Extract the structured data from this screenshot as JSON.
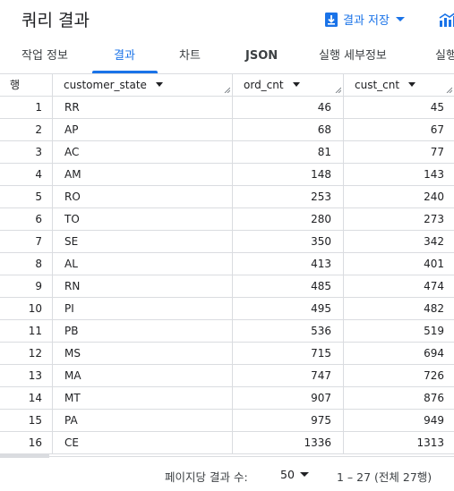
{
  "header": {
    "title": "쿼리 결과",
    "save_label": "결과 저장"
  },
  "tabs": [
    {
      "label": "작업 정보"
    },
    {
      "label": "결과"
    },
    {
      "label": "차트"
    },
    {
      "label": "JSON"
    },
    {
      "label": "실행 세부정보"
    },
    {
      "label": "실행"
    }
  ],
  "table": {
    "row_header": "행",
    "columns": [
      "customer_state",
      "ord_cnt",
      "cust_cnt"
    ],
    "rows": [
      {
        "n": "1",
        "state": "RR",
        "ord": "46",
        "cust": "45"
      },
      {
        "n": "2",
        "state": "AP",
        "ord": "68",
        "cust": "67"
      },
      {
        "n": "3",
        "state": "AC",
        "ord": "81",
        "cust": "77"
      },
      {
        "n": "4",
        "state": "AM",
        "ord": "148",
        "cust": "143"
      },
      {
        "n": "5",
        "state": "RO",
        "ord": "253",
        "cust": "240"
      },
      {
        "n": "6",
        "state": "TO",
        "ord": "280",
        "cust": "273"
      },
      {
        "n": "7",
        "state": "SE",
        "ord": "350",
        "cust": "342"
      },
      {
        "n": "8",
        "state": "AL",
        "ord": "413",
        "cust": "401"
      },
      {
        "n": "9",
        "state": "RN",
        "ord": "485",
        "cust": "474"
      },
      {
        "n": "10",
        "state": "PI",
        "ord": "495",
        "cust": "482"
      },
      {
        "n": "11",
        "state": "PB",
        "ord": "536",
        "cust": "519"
      },
      {
        "n": "12",
        "state": "MS",
        "ord": "715",
        "cust": "694"
      },
      {
        "n": "13",
        "state": "MA",
        "ord": "747",
        "cust": "726"
      },
      {
        "n": "14",
        "state": "MT",
        "ord": "907",
        "cust": "876"
      },
      {
        "n": "15",
        "state": "PA",
        "ord": "975",
        "cust": "949"
      },
      {
        "n": "16",
        "state": "CE",
        "ord": "1336",
        "cust": "1313"
      }
    ]
  },
  "footer": {
    "per_page_label": "페이지당 결과 수:",
    "per_page_value": "50",
    "range": "1 – 27 (전체 27행)"
  },
  "colors": {
    "accent": "#1a73e8",
    "border": "#dadce0",
    "text": "#202124"
  },
  "icons": {
    "save": "download-icon",
    "explore": "chart-explore-icon"
  }
}
